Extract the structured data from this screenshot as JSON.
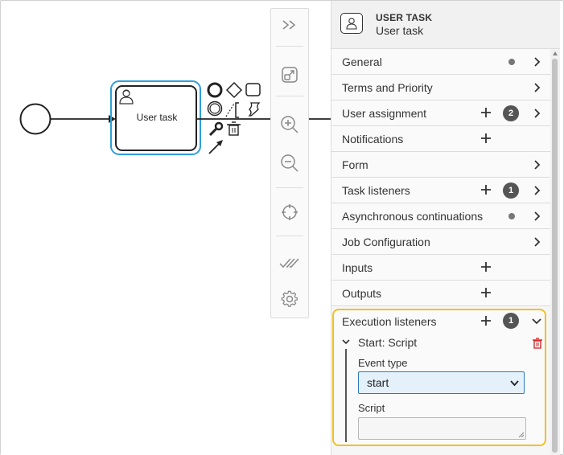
{
  "canvas": {
    "task_label": "User task"
  },
  "toolbar": {
    "tools": [
      {
        "icon": "double-chevron-right-icon"
      },
      {
        "icon": "fit-viewport-icon"
      },
      {
        "icon": "zoom-in-icon"
      },
      {
        "icon": "zoom-out-icon"
      },
      {
        "icon": "crosshair-icon"
      },
      {
        "icon": "double-check-icon"
      },
      {
        "icon": "gear-icon"
      }
    ]
  },
  "panel": {
    "header": {
      "type": "USER TASK",
      "name": "User task"
    },
    "groups": [
      {
        "title": "General",
        "dot": true,
        "chevron": true
      },
      {
        "title": "Terms and Priority",
        "chevron": true
      },
      {
        "title": "User assignment",
        "plus": true,
        "badge": "2",
        "chevron": true
      },
      {
        "title": "Notifications",
        "plus": true
      },
      {
        "title": "Form",
        "chevron": true
      },
      {
        "title": "Task listeners",
        "plus": true,
        "badge": "1",
        "chevron": true
      },
      {
        "title": "Asynchronous continuations",
        "dot": true,
        "chevron": true
      },
      {
        "title": "Job Configuration",
        "chevron": true
      },
      {
        "title": "Inputs",
        "plus": true
      },
      {
        "title": "Outputs",
        "plus": true
      }
    ],
    "execution_listeners": {
      "title": "Execution listeners",
      "badge": "1",
      "listener_title": "Start: Script",
      "event_type_label": "Event type",
      "event_type_value": "start",
      "script_label": "Script",
      "script_value": ""
    }
  },
  "colors": {
    "selection": "#2ea0d8",
    "highlight": "#f2c024",
    "delete": "#d62b2b",
    "select_bg": "#e4f1fb",
    "select_border": "#2b7bb9"
  }
}
